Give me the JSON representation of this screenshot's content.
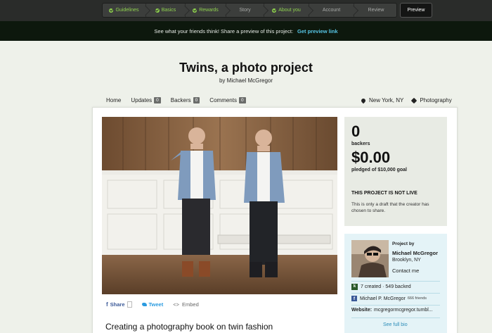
{
  "wizard": {
    "steps": [
      {
        "label": "Guidelines",
        "done": true
      },
      {
        "label": "Basics",
        "done": true
      },
      {
        "label": "Rewards",
        "done": true
      },
      {
        "label": "Story",
        "done": false
      },
      {
        "label": "About you",
        "done": true
      },
      {
        "label": "Account",
        "done": false
      },
      {
        "label": "Review",
        "done": false
      }
    ],
    "preview_label": "Preview"
  },
  "banner": {
    "text": "See what your friends think! Share a preview of this project:",
    "link": "Get preview link"
  },
  "project": {
    "title": "Twins, a photo project",
    "byline": "by Michael McGregor",
    "subtitle": "Creating a photography book on twin fashion"
  },
  "nav": {
    "home": "Home",
    "updates": "Updates",
    "updates_count": "0",
    "backers": "Backers",
    "backers_count": "0",
    "comments": "Comments",
    "comments_count": "0",
    "location": "New York, NY",
    "category": "Photography"
  },
  "share": {
    "share": "Share",
    "tweet": "Tweet",
    "embed": "Embed"
  },
  "stats": {
    "backers_num": "0",
    "backers_label": "backers",
    "pledged": "$0.00",
    "pledged_label": "pledged of $10,000 goal",
    "not_live": "THIS PROJECT IS NOT LIVE",
    "draft_note": "This is only a draft that the creator has chosen to share."
  },
  "creator": {
    "project_by": "Project by",
    "name": "Michael McGregor",
    "location": "Brooklyn, NY",
    "contact": "Contact me",
    "created_backed": "7 created · 549 backed",
    "facebook_name": "Michael P. McGregor",
    "facebook_friends": "666 friends",
    "website_label": "Website:",
    "website": "mcgregormcgregor.tumbl...",
    "see_full_bio": "See full bio"
  },
  "colors": {
    "accent_green": "#8fd14f",
    "link_blue": "#57c6e6",
    "facebook": "#3b5998",
    "twitter": "#2b9be0"
  }
}
